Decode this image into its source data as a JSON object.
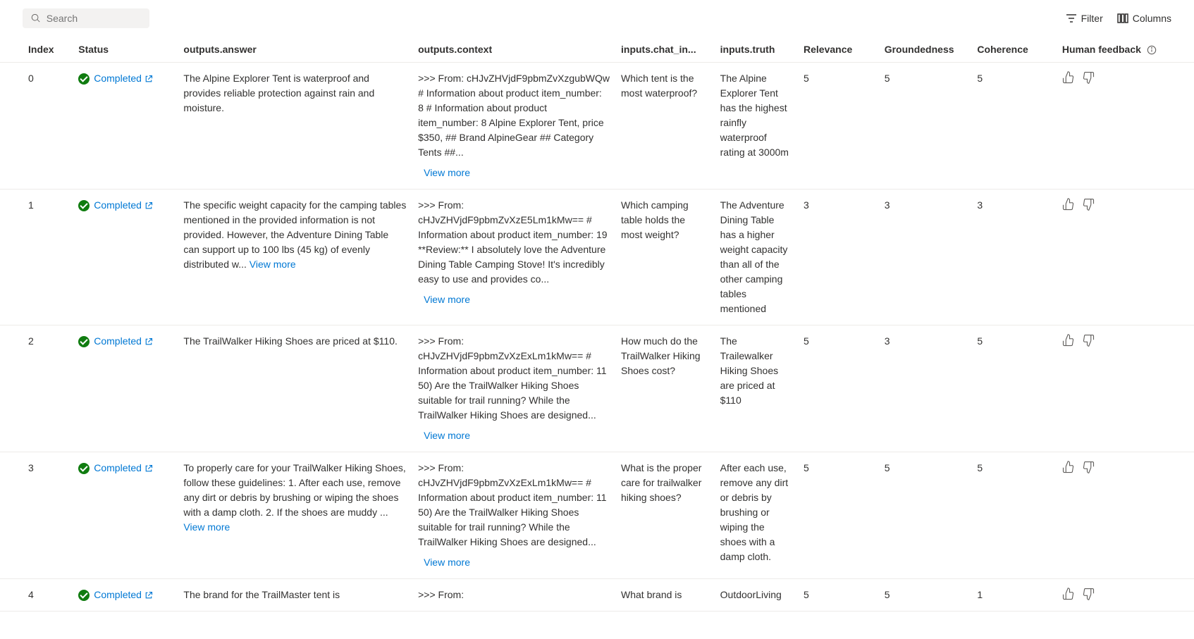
{
  "toolbar": {
    "search_placeholder": "Search",
    "filter_label": "Filter",
    "columns_label": "Columns"
  },
  "columns": {
    "index": "Index",
    "status": "Status",
    "answer": "outputs.answer",
    "context": "outputs.context",
    "chat_in": "inputs.chat_in...",
    "truth": "inputs.truth",
    "relevance": "Relevance",
    "groundedness": "Groundedness",
    "coherence": "Coherence",
    "feedback": "Human feedback"
  },
  "labels": {
    "view_more": "View more",
    "completed": "Completed"
  },
  "rows": [
    {
      "index": "0",
      "status": "Completed",
      "answer": "The Alpine Explorer Tent is waterproof and provides reliable protection against rain and moisture.",
      "answer_more": false,
      "context": ">>> From: cHJvZHVjdF9pbmZvXzgubWQw # Information about product item_number: 8 # Information about product item_number: 8 Alpine Explorer Tent, price $350, ## Brand AlpineGear ## Category Tents ##...",
      "chat_in": "Which tent is the most waterproof?",
      "truth": "The Alpine Explorer Tent has the highest rainfly waterproof rating at 3000m",
      "relevance": "5",
      "groundedness": "5",
      "coherence": "5"
    },
    {
      "index": "1",
      "status": "Completed",
      "answer": "The specific weight capacity for the camping tables mentioned in the provided information is not provided. However, the Adventure Dining Table can support up to 100 lbs (45 kg) of evenly distributed w... ",
      "answer_more": true,
      "context": ">>> From: cHJvZHVjdF9pbmZvXzE5Lm1kMw== # Information about product item_number: 19 **Review:** I absolutely love the Adventure Dining Table Camping Stove! It's incredibly easy to use and provides co...",
      "chat_in": "Which camping table holds the most weight?",
      "truth": "The Adventure Dining Table has a higher weight capacity than all of the other camping tables mentioned",
      "relevance": "3",
      "groundedness": "3",
      "coherence": "3"
    },
    {
      "index": "2",
      "status": "Completed",
      "answer": "The TrailWalker Hiking Shoes are priced at $110.",
      "answer_more": false,
      "context": ">>> From: cHJvZHVjdF9pbmZvXzExLm1kMw== # Information about product item_number: 11 50) Are the TrailWalker Hiking Shoes suitable for trail running? While the TrailWalker Hiking Shoes are designed...",
      "chat_in": "How much do the TrailWalker Hiking Shoes cost?",
      "truth": "The Trailewalker Hiking Shoes are priced at $110",
      "relevance": "5",
      "groundedness": "3",
      "coherence": "5"
    },
    {
      "index": "3",
      "status": "Completed",
      "answer": "To properly care for your TrailWalker Hiking Shoes, follow these guidelines: 1. After each use, remove any dirt or debris by brushing or wiping the shoes with a damp cloth. 2. If the shoes are muddy ... ",
      "answer_more": true,
      "context": ">>> From: cHJvZHVjdF9pbmZvXzExLm1kMw== # Information about product item_number: 11 50) Are the TrailWalker Hiking Shoes suitable for trail running? While the TrailWalker Hiking Shoes are designed...",
      "chat_in": "What is the proper care for trailwalker hiking shoes?",
      "truth": "After each use, remove any dirt or debris by brushing or wiping the shoes with a damp cloth.",
      "relevance": "5",
      "groundedness": "5",
      "coherence": "5"
    },
    {
      "index": "4",
      "status": "Completed",
      "answer": "The brand for the TrailMaster tent is",
      "answer_more": false,
      "context": ">>> From:",
      "context_more": false,
      "chat_in": "What brand is",
      "truth": "OutdoorLiving",
      "relevance": "5",
      "groundedness": "5",
      "coherence": "1"
    }
  ]
}
